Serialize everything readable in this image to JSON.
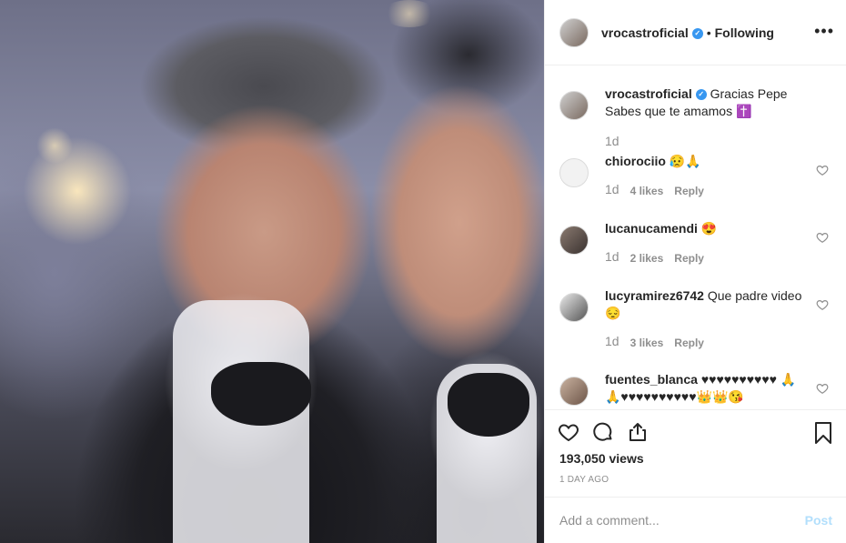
{
  "post": {
    "username": "vrocastroficial",
    "separator": "•",
    "follow_status": "Following",
    "more_icon": "more-options-icon"
  },
  "caption": {
    "username": "vrocastroficial",
    "text": "Gracias Pepe Sabes que te amamos ✝️",
    "age": "1d"
  },
  "comments": [
    {
      "username": "chiorociio",
      "text": "😥🙏",
      "age": "1d",
      "likes": "4 likes",
      "reply": "Reply"
    },
    {
      "username": "lucanucamendi",
      "text": "😍",
      "age": "1d",
      "likes": "2 likes",
      "reply": "Reply"
    },
    {
      "username": "lucyramirez6742",
      "text": "Que padre video😔",
      "age": "1d",
      "likes": "3 likes",
      "reply": "Reply"
    },
    {
      "username": "fuentes_blanca",
      "text": "♥♥♥♥♥♥♥♥♥♥ 🙏🙏♥♥♥♥♥♥♥♥♥♥👑👑😘",
      "age": "",
      "likes": "",
      "reply": ""
    }
  ],
  "actions": {
    "views": "193,050 views",
    "time": "1 DAY AGO"
  },
  "add_comment": {
    "placeholder": "Add a comment...",
    "post_label": "Post"
  },
  "colors": {
    "accent": "#3897f0",
    "post_disabled": "#b2dffc",
    "secondary_text": "#8e8e8e"
  }
}
